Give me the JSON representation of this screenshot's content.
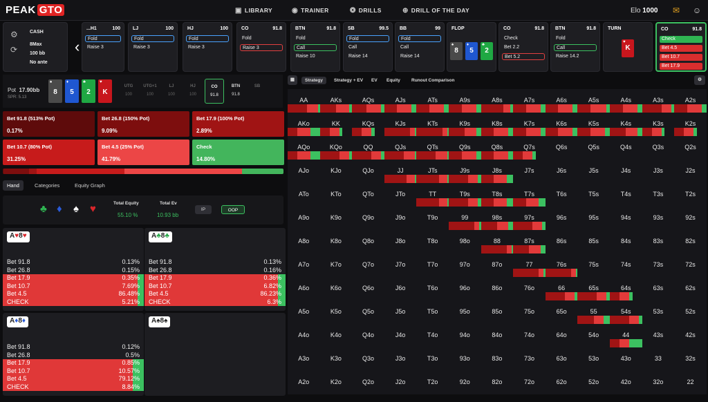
{
  "header": {
    "logo_a": "PEAK",
    "logo_b": "GTO",
    "nav": [
      {
        "icon": "▣",
        "label": "LIBRARY"
      },
      {
        "icon": "◉",
        "label": "TRAINER"
      },
      {
        "icon": "❂",
        "label": "DRILLS"
      },
      {
        "icon": "⊕",
        "label": "DRILL OF THE DAY"
      }
    ],
    "elo_label": "Elo",
    "elo_value": "1000",
    "chat_icon": "✉",
    "account_icon": "☺"
  },
  "settings": {
    "format": "CASH",
    "table": "8Max",
    "stack": "100 bb",
    "ante": "No ante"
  },
  "actions": [
    {
      "pos": "...H1",
      "stack": "100",
      "lines": [
        {
          "t": "Fold",
          "c": "sel"
        },
        {
          "t": "Raise 3",
          "c": ""
        }
      ]
    },
    {
      "pos": "LJ",
      "stack": "100",
      "lines": [
        {
          "t": "Fold",
          "c": "sel"
        },
        {
          "t": "Raise 3",
          "c": ""
        }
      ]
    },
    {
      "pos": "HJ",
      "stack": "100",
      "lines": [
        {
          "t": "Fold",
          "c": "sel"
        },
        {
          "t": "Raise 3",
          "c": ""
        }
      ]
    },
    {
      "pos": "CO",
      "stack": "91.8",
      "lines": [
        {
          "t": "Fold",
          "c": ""
        },
        {
          "t": "Raise 3",
          "c": "selr"
        }
      ]
    },
    {
      "pos": "BTN",
      "stack": "91.8",
      "lines": [
        {
          "t": "Fold",
          "c": ""
        },
        {
          "t": "Call",
          "c": "selg"
        },
        {
          "t": "Raise 10",
          "c": ""
        }
      ]
    },
    {
      "pos": "SB",
      "stack": "99.5",
      "lines": [
        {
          "t": "Fold",
          "c": "sel"
        },
        {
          "t": "Call",
          "c": ""
        },
        {
          "t": "Raise 14",
          "c": ""
        }
      ]
    },
    {
      "pos": "BB",
      "stack": "99",
      "lines": [
        {
          "t": "Fold",
          "c": "sel"
        },
        {
          "t": "Call",
          "c": ""
        },
        {
          "t": "Raise 14",
          "c": ""
        }
      ]
    },
    {
      "pos": "FLOP",
      "stack": "",
      "lines": []
    },
    {
      "pos": "CO",
      "stack": "91.8",
      "lines": [
        {
          "t": "Check",
          "c": ""
        },
        {
          "t": "Bet 2.2",
          "c": ""
        },
        {
          "t": "Bet 5.2",
          "c": "selr"
        }
      ]
    },
    {
      "pos": "BTN",
      "stack": "91.8",
      "lines": [
        {
          "t": "Fold",
          "c": ""
        },
        {
          "t": "Call",
          "c": "selg"
        },
        {
          "t": "Raise 14.2",
          "c": ""
        }
      ]
    },
    {
      "pos": "TURN",
      "stack": "",
      "lines": []
    },
    {
      "pos": "CO",
      "stack": "91.8",
      "lines": [
        {
          "t": "Check",
          "c": "fillg"
        },
        {
          "t": "Bet 4.5",
          "c": "fillr"
        },
        {
          "t": "Bet 10.7",
          "c": "fillr"
        },
        {
          "t": "Bet 17.9",
          "c": "fillr"
        }
      ]
    }
  ],
  "flop_cards": [
    {
      "r": "8",
      "s": "♠",
      "bg": "#4a4a4a"
    },
    {
      "r": "5",
      "s": "♦",
      "bg": "#1f57d1"
    },
    {
      "r": "2",
      "s": "♣",
      "bg": "#1fa843"
    }
  ],
  "turn_card": {
    "r": "K",
    "s": "♥",
    "bg": "#c8161d"
  },
  "pot": {
    "label": "Pot",
    "value": "17.90bb",
    "spr": "SPR: 5.13"
  },
  "pot_cards": [
    {
      "r": "8",
      "s": "♠",
      "bg": "#4a4a4a"
    },
    {
      "r": "5",
      "s": "♦",
      "bg": "#1f57d1"
    },
    {
      "r": "2",
      "s": "♣",
      "bg": "#1fa843"
    },
    {
      "r": "K",
      "s": "♥",
      "bg": "#c8161d"
    }
  ],
  "mini_positions": [
    {
      "p": "UTG",
      "v": "100"
    },
    {
      "p": "UTG+1",
      "v": "100"
    },
    {
      "p": "LJ",
      "v": "100"
    },
    {
      "p": "HJ",
      "v": "100"
    },
    {
      "p": "CO",
      "v": "91.8"
    },
    {
      "p": "BTN",
      "v": "91.8"
    },
    {
      "p": "SB",
      "v": ""
    }
  ],
  "strategy": [
    {
      "label": "Bet 91.8 (513% Pot)",
      "pct": "0.17%",
      "color": "#5e0b0b"
    },
    {
      "label": "Bet 26.8 (150% Pot)",
      "pct": "9.09%",
      "color": "#7d0e0e"
    },
    {
      "label": "Bet 17.9 (100% Pot)",
      "pct": "2.89%",
      "color": "#a01414"
    },
    {
      "label": "Bet 10.7 (80% Pot)",
      "pct": "31.25%",
      "color": "#c71b1b"
    },
    {
      "label": "Bet 4.5 (25% Pot)",
      "pct": "41.79%",
      "color": "#ec4646"
    },
    {
      "label": "Check",
      "pct": "14.80%",
      "color": "#43b55c"
    }
  ],
  "freq_bar": [
    {
      "w": 0.17,
      "c": "#5e0b0b"
    },
    {
      "w": 9.09,
      "c": "#7d0e0e"
    },
    {
      "w": 2.89,
      "c": "#a01414"
    },
    {
      "w": 31.25,
      "c": "#c71b1b"
    },
    {
      "w": 41.79,
      "c": "#ec4646"
    },
    {
      "w": 14.8,
      "c": "#43b55c"
    }
  ],
  "tabs": [
    "Hand",
    "Categories",
    "Equity Graph"
  ],
  "equity": {
    "total_equity_label": "Total Equity",
    "total_equity": "55.10 %",
    "total_ev_label": "Total Ev",
    "total_ev": "10.93 bb",
    "ip": "IP",
    "oop": "OOP",
    "suits": [
      {
        "s": "♣",
        "c": "#2fb552"
      },
      {
        "s": "♦",
        "c": "#2a5bd9"
      },
      {
        "s": "♠",
        "c": "#ffffff"
      },
      {
        "s": "♥",
        "c": "#d9262b"
      }
    ]
  },
  "hands": [
    {
      "combo": [
        {
          "t": "A",
          "c": "k"
        },
        {
          "t": "♥",
          "c": "r"
        },
        {
          "t": "8",
          "c": "k"
        },
        {
          "t": "♥",
          "c": "r"
        }
      ],
      "rows": [
        [
          "Bet 91.8",
          "0.13%"
        ],
        [
          "Bet 26.8",
          "0.15%"
        ],
        [
          "Bet 17.9",
          "0.35%"
        ],
        [
          "Bet 10.7",
          "7.69%"
        ],
        [
          "Bet 4.5",
          "86.48%"
        ],
        [
          "CHECK",
          "5.21%"
        ]
      ],
      "g": 5.21
    },
    {
      "combo": [
        {
          "t": "A",
          "c": "k"
        },
        {
          "t": "♣",
          "c": "g"
        },
        {
          "t": "8",
          "c": "k"
        },
        {
          "t": "♣",
          "c": "g"
        }
      ],
      "rows": [
        [
          "Bet 91.8",
          "0.13%"
        ],
        [
          "Bet 26.8",
          "0.16%"
        ],
        [
          "Bet 17.9",
          "0.36%"
        ],
        [
          "Bet 10.7",
          "6.82%"
        ],
        [
          "Bet 4.5",
          "86.23%"
        ],
        [
          "CHECK",
          "6.3%"
        ]
      ],
      "g": 6.3
    },
    {
      "combo": [
        {
          "t": "A",
          "c": "k"
        },
        {
          "t": "♦",
          "c": "b"
        },
        {
          "t": "8",
          "c": "k"
        },
        {
          "t": "♦",
          "c": "b"
        }
      ],
      "rows": [
        [
          "Bet 91.8",
          "0.12%"
        ],
        [
          "Bet 26.8",
          "0.5%"
        ],
        [
          "Bet 17.9",
          "0.85%"
        ],
        [
          "Bet 10.7",
          "10.57%"
        ],
        [
          "Bet 4.5",
          "79.12%"
        ],
        [
          "CHECK",
          "8.84%"
        ]
      ],
      "g": 8.84
    },
    {
      "combo": [
        {
          "t": "A",
          "c": "k"
        },
        {
          "t": "♠",
          "c": "k"
        },
        {
          "t": "8",
          "c": "k"
        },
        {
          "t": "♠",
          "c": "k"
        }
      ],
      "rows": [],
      "g": 0
    }
  ],
  "matrix_toolbar": [
    "Strategy",
    "Strategy + EV",
    "EV",
    "Equity",
    "Runout Comparison"
  ],
  "matrix": {
    "ranks": [
      "A",
      "K",
      "Q",
      "J",
      "T",
      "9",
      "8",
      "7",
      "6",
      "5",
      "4",
      "3",
      "2"
    ],
    "bars": {
      "AA": [
        0.6,
        0.35,
        0.05
      ],
      "AKs": [
        0.5,
        0.4,
        0.1
      ],
      "AQs": [
        0.45,
        0.45,
        0.1
      ],
      "AJs": [
        0.4,
        0.45,
        0.15
      ],
      "ATs": [
        0.4,
        0.45,
        0.15
      ],
      "A9s": [
        0.4,
        0.45,
        0.15
      ],
      "A8s": [
        0.7,
        0.2,
        0.1
      ],
      "A7s": [
        0.4,
        0.45,
        0.15
      ],
      "A6s": [
        0.4,
        0.45,
        0.15
      ],
      "A5s": [
        0.4,
        0.5,
        0.1
      ],
      "A4s": [
        0.4,
        0.45,
        0.15
      ],
      "A3s": [
        0.6,
        0.3,
        0.1
      ],
      "A2s": [
        0.4,
        0.45,
        0.15
      ],
      "KJs": [
        0.8,
        0.15,
        0.05
      ],
      "KTs": [
        0.8,
        0.15,
        0.05
      ],
      "K9s": [
        0.5,
        0.35,
        0.15
      ],
      "K8s": [
        0.4,
        0.45,
        0.15
      ],
      "K7s": [
        0.4,
        0.45,
        0.15
      ],
      "K6s": [
        0.4,
        0.45,
        0.15
      ],
      "K5s": [
        0.4,
        0.45,
        0.15
      ],
      "K4s": [
        0.5,
        0.35,
        0.15
      ],
      "K3s": [
        0.3,
        0.3,
        0.1
      ],
      "K2s": [
        0.3,
        0.3,
        0.1
      ],
      "AKo": [
        0.3,
        0.4,
        0.3
      ],
      "KK": [
        0.3,
        0.3,
        0.1
      ],
      "KQs": [
        0.3,
        0.3,
        0.1
      ],
      "AQo": [
        0.3,
        0.4,
        0.3
      ],
      "KQo": [
        0.6,
        0.3,
        0.1
      ],
      "QQ": [
        0.6,
        0.3,
        0.1
      ],
      "QJs": [
        0.6,
        0.35,
        0.05
      ],
      "QTs": [
        0.6,
        0.35,
        0.05
      ],
      "Q9s": [
        0.4,
        0.45,
        0.15
      ],
      "Q8s": [
        0.4,
        0.45,
        0.15
      ],
      "Q7s": [
        0.3,
        0.3,
        0.1
      ],
      "JJ": [
        0.7,
        0.25,
        0.05
      ],
      "JTs": [
        0.7,
        0.25,
        0.05
      ],
      "J9s": [
        0.6,
        0.3,
        0.1
      ],
      "J8s": [
        0.4,
        0.4,
        0.2
      ],
      "TT": [
        0.7,
        0.25,
        0.05
      ],
      "T9s": [
        0.6,
        0.3,
        0.1
      ],
      "T8s": [
        0.4,
        0.4,
        0.2
      ],
      "T7s": [
        0.4,
        0.4,
        0.2
      ],
      "99": [
        0.8,
        0.15,
        0.05
      ],
      "98s": [
        0.5,
        0.35,
        0.15
      ],
      "97s": [
        0.6,
        0.3,
        0.1
      ],
      "88": [
        0.8,
        0.15,
        0.05
      ],
      "87s": [
        0.5,
        0.35,
        0.15
      ],
      "77": [
        0.8,
        0.15,
        0.05
      ],
      "76s": [
        0.8,
        0.15,
        0.05
      ],
      "66": [
        0.6,
        0.3,
        0.1
      ],
      "65s": [
        0.6,
        0.3,
        0.1
      ],
      "64s": [
        0.3,
        0.3,
        0.1
      ],
      "55": [
        0.5,
        0.3,
        0.2
      ],
      "54s": [
        0.6,
        0.3,
        0.1
      ],
      "44": [
        0.3,
        0.3,
        0.4
      ]
    }
  }
}
